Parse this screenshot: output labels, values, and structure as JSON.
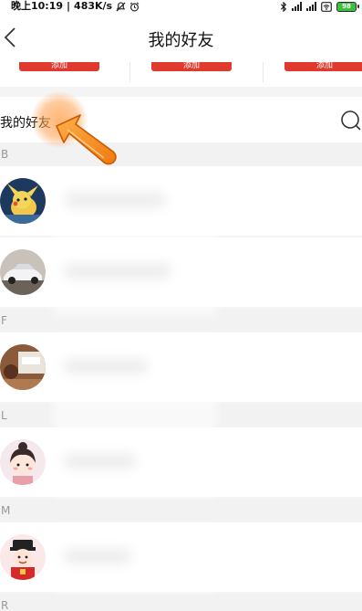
{
  "status_bar": {
    "time": "晚上10:19",
    "speed": "483K/s",
    "battery": "98"
  },
  "header": {
    "title": "我的好友"
  },
  "recommend": {
    "buttons": [
      "添加",
      "添加",
      "添加"
    ]
  },
  "section": {
    "title": "我的好友"
  },
  "friends": {
    "groups": [
      {
        "letter": "B"
      },
      {
        "letter": "F"
      },
      {
        "letter": "L"
      },
      {
        "letter": "M"
      },
      {
        "letter": "R"
      }
    ],
    "accent_color": "#e03a2f"
  }
}
